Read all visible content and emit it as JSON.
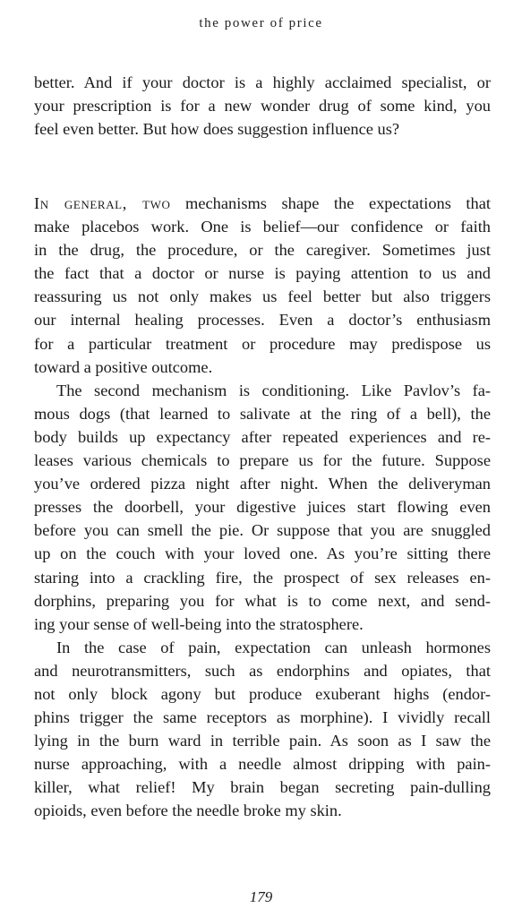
{
  "running_head": "the power of price",
  "page_number": "179",
  "para1": [
    "better. And if your doctor is a highly acclaimed specialist, or",
    "your prescription is for a new wonder drug of some kind, you",
    "feel even better. But how does suggestion influence us?"
  ],
  "para2": {
    "lead_in": "In general, two",
    "first_line_rest": " mechanisms shape the expectations that",
    "lines": [
      "make placebos work. One is belief—our confidence or faith",
      "in the drug, the procedure, or the caregiver. Sometimes just",
      "the fact that a doctor or nurse is paying attention to us and",
      "reassuring us not only makes us feel better but also triggers",
      "our internal healing processes. Even a doctor’s enthusiasm",
      "for a particular treatment or procedure may predispose us",
      "toward a positive outcome."
    ]
  },
  "para3": [
    "The second mechanism is conditioning. Like Pavlov’s fa-",
    "mous dogs (that learned to salivate at the ring of a bell), the",
    "body builds up expectancy after repeated experiences and re-",
    "leases various chemicals to prepare us for the future. Suppose",
    "you’ve ordered pizza night after night. When the deliveryman",
    "presses the doorbell, your digestive juices start flowing even",
    "before you can smell the pie. Or suppose that you are snuggled",
    "up on the couch with your loved one. As you’re sitting there",
    "staring into a crackling fire, the prospect of sex releases en-",
    "dorphins, preparing you for what is to come next, and send-",
    "ing your sense of well-being into the stratosphere."
  ],
  "para4": [
    "In the case of pain, expectation can unleash hormones",
    "and neurotransmitters, such as endorphins and opiates, that",
    "not only block agony but produce exuberant highs (endor-",
    "phins trigger the same receptors as morphine). I vividly recall",
    "lying in the burn ward in terrible pain. As soon as I saw the",
    "nurse approaching, with a needle almost dripping with pain-",
    "killer, what relief! My brain began secreting pain-dulling",
    "opioids, even before the needle broke my skin."
  ]
}
